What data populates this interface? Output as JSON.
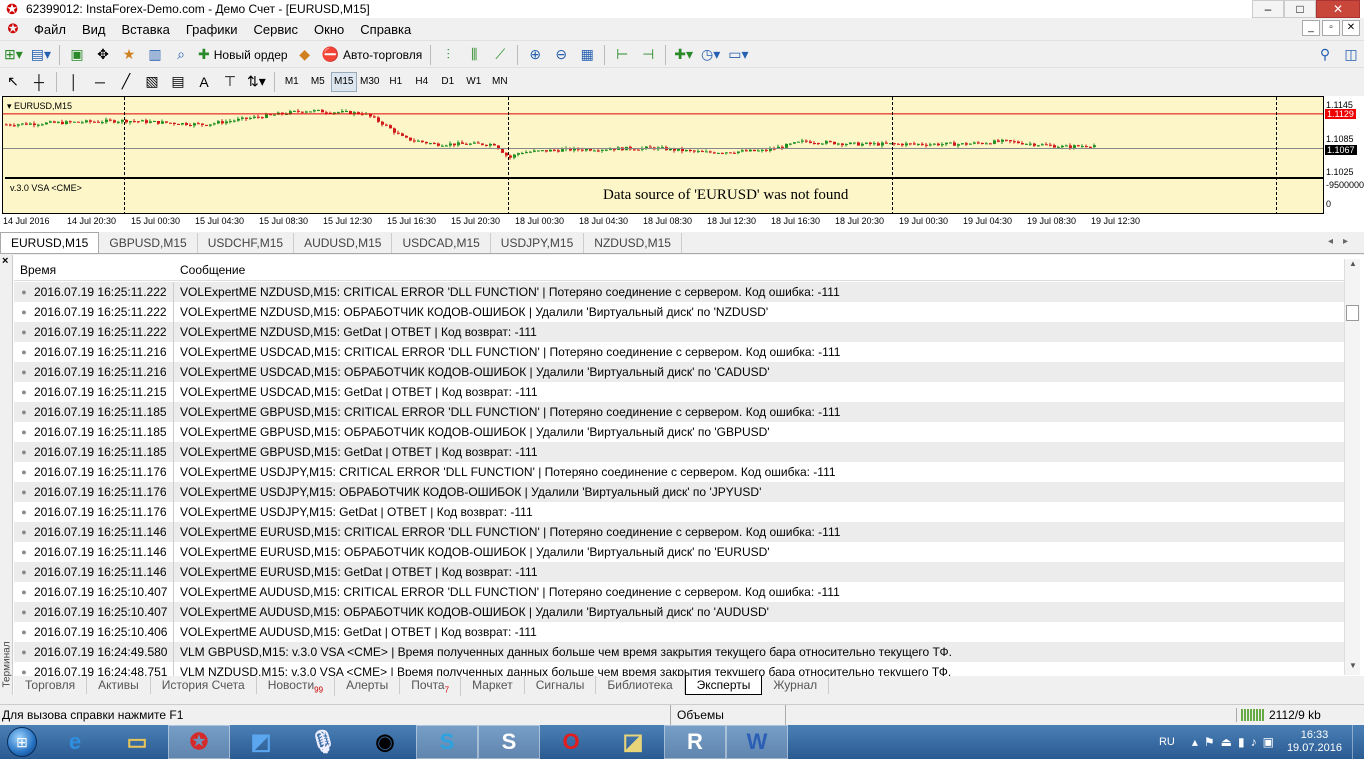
{
  "window": {
    "title": "62399012: InstaForex-Demo.com - Демо Счет - [EURUSD,M15]",
    "controls": [
      "–",
      "□",
      "✕"
    ]
  },
  "menu": {
    "items": [
      "Файл",
      "Вид",
      "Вставка",
      "Графики",
      "Сервис",
      "Окно",
      "Справка"
    ],
    "mdi_controls": [
      "_",
      "▫",
      "✕"
    ]
  },
  "toolbar": {
    "new_order": "Новый ордер",
    "auto_trading": "Авто-торговля",
    "timeframes": [
      "M1",
      "M5",
      "M15",
      "M30",
      "H1",
      "H4",
      "D1",
      "W1",
      "MN"
    ],
    "active_timeframe": "M15",
    "text_tool": "A"
  },
  "chart": {
    "label": "EURUSD,M15",
    "price_scale": [
      "1.1145",
      "1.1085",
      "1.1025"
    ],
    "current_price": "1.1067",
    "ask_price": "1.1129",
    "indicator_label": "v.3.0 VSA <CME>",
    "indicator_message": "Data source of 'EURUSD' was not found",
    "indicator_scale": [
      "-9500000",
      "0"
    ],
    "time_labels": [
      "14 Jul 2016",
      "14 Jul 20:30",
      "15 Jul 00:30",
      "15 Jul 04:30",
      "15 Jul 08:30",
      "15 Jul 12:30",
      "15 Jul 16:30",
      "15 Jul 20:30",
      "18 Jul 00:30",
      "18 Jul 04:30",
      "18 Jul 08:30",
      "18 Jul 12:30",
      "18 Jul 16:30",
      "18 Jul 20:30",
      "19 Jul 00:30",
      "19 Jul 04:30",
      "19 Jul 08:30",
      "19 Jul 12:30"
    ],
    "colors": {
      "background": "#fdf6c8",
      "bull": "#1f8f1f",
      "bear": "#d01818",
      "ask_line": "#e00000"
    }
  },
  "symbol_tabs": [
    "EURUSD,M15",
    "GBPUSD,M15",
    "USDCHF,M15",
    "AUDUSD,M15",
    "USDCAD,M15",
    "USDJPY,M15",
    "NZDUSD,M15"
  ],
  "terminal": {
    "side_label": "Терминал",
    "columns": {
      "time": "Время",
      "message": "Сообщение"
    },
    "rows": [
      {
        "time": "2016.07.19 16:25:11.222",
        "message": "VOLExpertME NZDUSD,M15: CRITICAL ERROR 'DLL FUNCTION' | Потеряно соединение с сервером. Код ошибка: -111"
      },
      {
        "time": "2016.07.19 16:25:11.222",
        "message": "VOLExpertME NZDUSD,M15:  ОБРАБОТЧИК КОДОВ-ОШИБОК | Удалили 'Виртуальный диск' по 'NZDUSD'"
      },
      {
        "time": "2016.07.19 16:25:11.222",
        "message": "VOLExpertME NZDUSD,M15:  GetDat | ОТВЕТ | Код возврат: -111"
      },
      {
        "time": "2016.07.19 16:25:11.216",
        "message": "VOLExpertME USDCAD,M15: CRITICAL ERROR 'DLL FUNCTION' | Потеряно соединение с сервером. Код ошибка: -111"
      },
      {
        "time": "2016.07.19 16:25:11.216",
        "message": "VOLExpertME USDCAD,M15:  ОБРАБОТЧИК КОДОВ-ОШИБОК | Удалили 'Виртуальный диск' по 'CADUSD'"
      },
      {
        "time": "2016.07.19 16:25:11.215",
        "message": "VOLExpertME USDCAD,M15:  GetDat | ОТВЕТ | Код возврат: -111"
      },
      {
        "time": "2016.07.19 16:25:11.185",
        "message": "VOLExpertME GBPUSD,M15: CRITICAL ERROR 'DLL FUNCTION' | Потеряно соединение с сервером. Код ошибка: -111"
      },
      {
        "time": "2016.07.19 16:25:11.185",
        "message": "VOLExpertME GBPUSD,M15:  ОБРАБОТЧИК КОДОВ-ОШИБОК | Удалили 'Виртуальный диск' по 'GBPUSD'"
      },
      {
        "time": "2016.07.19 16:25:11.185",
        "message": "VOLExpertME GBPUSD,M15:  GetDat | ОТВЕТ | Код возврат: -111"
      },
      {
        "time": "2016.07.19 16:25:11.176",
        "message": "VOLExpertME USDJPY,M15: CRITICAL ERROR 'DLL FUNCTION' | Потеряно соединение с сервером. Код ошибка: -111"
      },
      {
        "time": "2016.07.19 16:25:11.176",
        "message": "VOLExpertME USDJPY,M15:  ОБРАБОТЧИК КОДОВ-ОШИБОК | Удалили 'Виртуальный диск' по 'JPYUSD'"
      },
      {
        "time": "2016.07.19 16:25:11.176",
        "message": "VOLExpertME USDJPY,M15:  GetDat | ОТВЕТ | Код возврат: -111"
      },
      {
        "time": "2016.07.19 16:25:11.146",
        "message": "VOLExpertME EURUSD,M15: CRITICAL ERROR 'DLL FUNCTION' | Потеряно соединение с сервером. Код ошибка: -111"
      },
      {
        "time": "2016.07.19 16:25:11.146",
        "message": "VOLExpertME EURUSD,M15:  ОБРАБОТЧИК КОДОВ-ОШИБОК | Удалили 'Виртуальный диск' по 'EURUSD'"
      },
      {
        "time": "2016.07.19 16:25:11.146",
        "message": "VOLExpertME EURUSD,M15:  GetDat | ОТВЕТ | Код возврат: -111"
      },
      {
        "time": "2016.07.19 16:25:10.407",
        "message": "VOLExpertME AUDUSD,M15: CRITICAL ERROR 'DLL FUNCTION' | Потеряно соединение с сервером. Код ошибка: -111"
      },
      {
        "time": "2016.07.19 16:25:10.407",
        "message": "VOLExpertME AUDUSD,M15:  ОБРАБОТЧИК КОДОВ-ОШИБОК | Удалили 'Виртуальный диск' по 'AUDUSD'"
      },
      {
        "time": "2016.07.19 16:25:10.406",
        "message": "VOLExpertME AUDUSD,M15:  GetDat | ОТВЕТ | Код возврат: -111"
      },
      {
        "time": "2016.07.19 16:24:49.580",
        "message": "VLM GBPUSD,M15: v.3.0 VSA <CME> | Время полученных данных больше чем время закрытия текущего бара относительно текущего ТФ."
      },
      {
        "time": "2016.07.19 16:24:48.751",
        "message": "VLM NZDUSD,M15: v.3.0 VSA <CME> | Время полученных данных больше чем время закрытия текущего бара относительно текущего ТФ."
      }
    ],
    "tabs": [
      {
        "label": "Торговля"
      },
      {
        "label": "Активы"
      },
      {
        "label": "История Счета"
      },
      {
        "label": "Новости",
        "badge": "99"
      },
      {
        "label": "Алерты"
      },
      {
        "label": "Почта",
        "badge": "7"
      },
      {
        "label": "Маркет"
      },
      {
        "label": "Сигналы"
      },
      {
        "label": "Библиотека"
      },
      {
        "label": "Эксперты"
      },
      {
        "label": "Журнал"
      }
    ],
    "active_tab": "Эксперты"
  },
  "status": {
    "help": "Для вызова справки нажмите F1",
    "profile": "Объемы",
    "traffic": "2112/9 kb"
  },
  "taskbar": {
    "lang": "RU",
    "time": "16:33",
    "date": "19.07.2016"
  }
}
